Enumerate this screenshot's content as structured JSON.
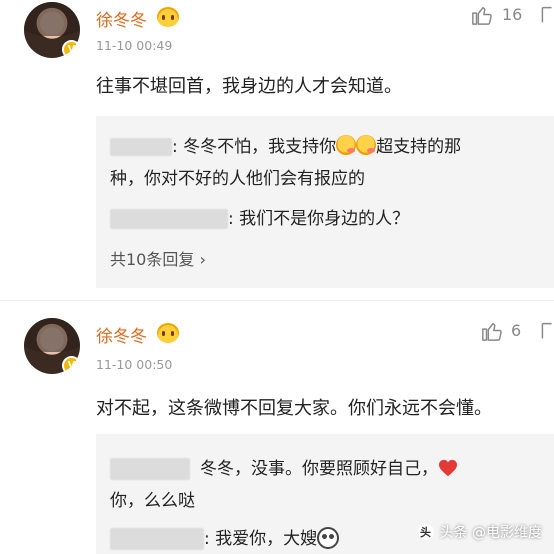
{
  "comments": [
    {
      "username": "徐冬冬",
      "timestamp": "11-10 00:49",
      "likes": "16",
      "text": "往事不堪回首，我身边的人才会知道。",
      "replies": {
        "r1_part1": ": 冬冬不怕，我支持你",
        "r1_part2": "超支持的那",
        "r1_line2": "种，你对不好的人他们会有报应的",
        "r2": ": 我们不是你身边的人？",
        "more": "共10条回复 ›"
      }
    },
    {
      "username": "徐冬冬",
      "timestamp": "11-10 00:50",
      "likes": "6",
      "text": "对不起，这条微博不回复大家。你们永远不会懂。",
      "replies": {
        "r1_part1": "冬冬，没事。你要照顾好自己，",
        "r1_line2": "你，么么哒",
        "r2": ": 我爱你，大嫂"
      }
    }
  ],
  "watermark": {
    "text": "头条 @电影维度"
  },
  "colors": {
    "username": "#e36a21",
    "like_gray": "#888888",
    "reply_bg": "#f4f4f4",
    "heart": "#e53935"
  }
}
